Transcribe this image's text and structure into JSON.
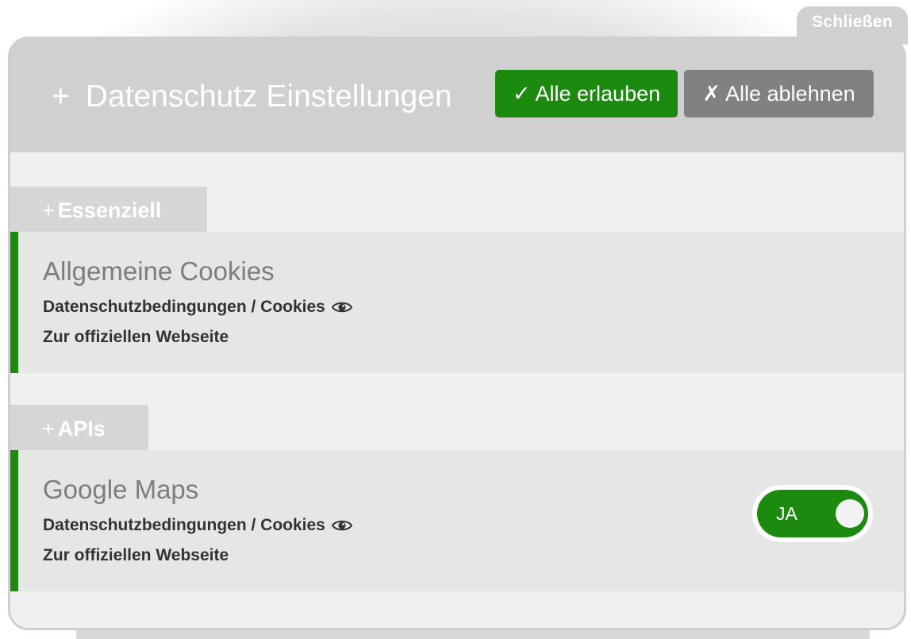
{
  "close_label": "Schließen",
  "header": {
    "title": "Datenschutz Einstellungen",
    "title_icon": "plus-icon",
    "accept_all": "✓ Alle erlauben",
    "reject_all": "✗ Alle ablehnen"
  },
  "categories": [
    {
      "label": "Essenziell",
      "icon": "plus-icon",
      "item": {
        "title": "Allgemeine Cookies",
        "privacy_link": "Datenschutzbedingungen / Cookies",
        "website_link": "Zur offiziellen Webseite"
      }
    },
    {
      "label": "APIs",
      "icon": "plus-icon",
      "item": {
        "title": "Google Maps",
        "privacy_link": "Datenschutzbedingungen / Cookies",
        "website_link": "Zur offiziellen Webseite",
        "toggle": {
          "label": "JA",
          "state": "on"
        }
      }
    }
  ],
  "colors": {
    "accent_green": "#1b8a0e",
    "reject_gray": "#818181",
    "header_bg": "#d0d0d0",
    "content_bg": "#f0f0f0",
    "card_bg": "#e6e6e6"
  }
}
